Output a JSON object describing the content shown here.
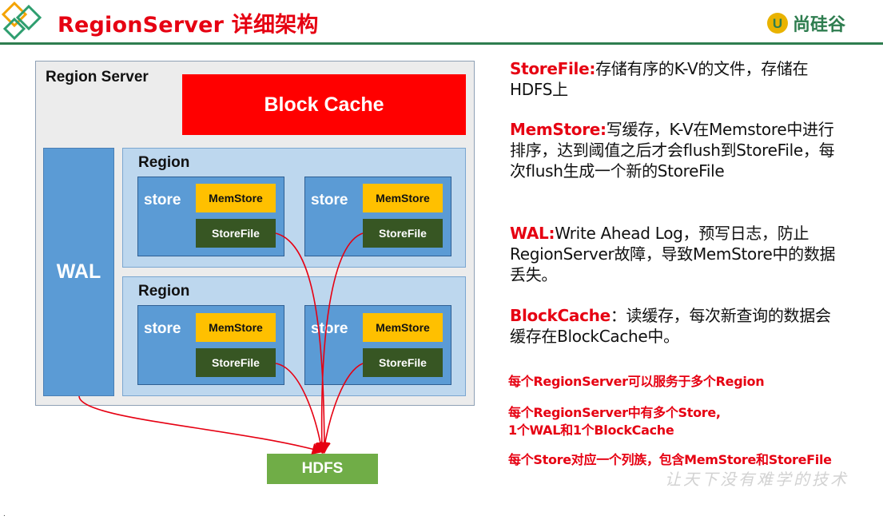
{
  "header": {
    "title": "RegionServer 详细架构",
    "brand": "尚硅谷",
    "brand_mark": "U"
  },
  "diagram": {
    "region_server_label": "Region Server",
    "block_cache_label": "Block Cache",
    "wal_label": "WAL",
    "hdfs_label": "HDFS",
    "regions": [
      {
        "label": "Region",
        "stores": [
          {
            "label": "store",
            "memstore": "MemStore",
            "storefile": "StoreFile"
          },
          {
            "label": "store",
            "memstore": "MemStore",
            "storefile": "StoreFile"
          }
        ]
      },
      {
        "label": "Region",
        "stores": [
          {
            "label": "store",
            "memstore": "MemStore",
            "storefile": "StoreFile"
          },
          {
            "label": "store",
            "memstore": "MemStore",
            "storefile": "StoreFile"
          }
        ]
      }
    ]
  },
  "descriptions": [
    {
      "term": "StoreFile:",
      "text": "存储有序的K-V的文件，存储在HDFS上"
    },
    {
      "term": "MemStore:",
      "text": "写缓存，K-V在Memstore中进行排序，达到阈值之后才会flush到StoreFile，每次flush生成一个新的StoreFile"
    },
    {
      "term": "WAL:",
      "text": "Write Ahead Log，预写日志，防止RegionServer故障，导致MemStore中的数据丢失。"
    },
    {
      "term": "BlockCache",
      "text": "：读缓存，每次新查询的数据会缓存在BlockCache中。"
    }
  ],
  "notes": {
    "note1": "每个RegionServer可以服务于多个Region",
    "note2_line1": "每个RegionServer中有多个Store,",
    "note2_line2": "1个WAL和1个BlockCache",
    "note3": "每个Store对应一个列族，包含MemStore和StoreFile"
  },
  "watermark": "让天下没有难学的技术",
  "corner_mark": ".",
  "colors": {
    "title_red": "#e60012",
    "block_cache": "#ff0000",
    "wal_store": "#5b9bd5",
    "region_bg": "#bdd7ee",
    "memstore": "#ffc000",
    "storefile": "#375623",
    "hdfs": "#70ad47",
    "brand_green": "#2e7d4f",
    "arrow": "#e60012"
  }
}
